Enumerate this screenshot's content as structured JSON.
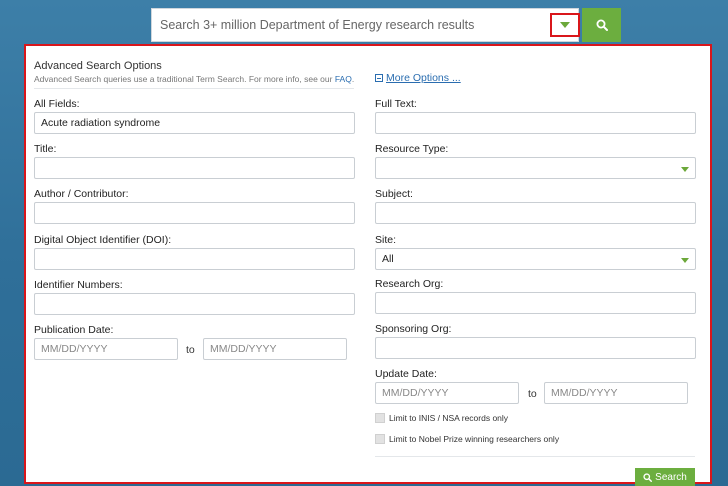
{
  "search": {
    "placeholder": "Search 3+ million Department of Energy research results"
  },
  "panel": {
    "title": "Advanced Search Options",
    "subtitle_prefix": "Advanced Search queries use a traditional Term Search. For more info, see our ",
    "faq_link": "FAQ",
    "subtitle_suffix": ".",
    "more_options": "More Options ..."
  },
  "left_fields": {
    "all_fields": {
      "label": "All Fields:",
      "value": "Acute radiation syndrome"
    },
    "title": {
      "label": "Title:"
    },
    "author": {
      "label": "Author / Contributor:"
    },
    "doi": {
      "label": "Digital Object Identifier (DOI):"
    },
    "identifier": {
      "label": "Identifier Numbers:"
    },
    "pub_date": {
      "label": "Publication Date:",
      "from_placeholder": "MM/DD/YYYY",
      "to_label": "to",
      "to_placeholder": "MM/DD/YYYY"
    }
  },
  "right_fields": {
    "full_text": {
      "label": "Full Text:"
    },
    "resource_type": {
      "label": "Resource Type:",
      "value": ""
    },
    "subject": {
      "label": "Subject:"
    },
    "site": {
      "label": "Site:",
      "value": "All"
    },
    "research_org": {
      "label": "Research Org:"
    },
    "sponsoring_org": {
      "label": "Sponsoring Org:"
    },
    "update_date": {
      "label": "Update Date:",
      "from_placeholder": "MM/DD/YYYY",
      "to_label": "to",
      "to_placeholder": "MM/DD/YYYY"
    },
    "limit_inis": "Limit to INIS / NSA records only",
    "limit_nobel": "Limit to Nobel Prize winning researchers only"
  },
  "buttons": {
    "search": "Search"
  },
  "colors": {
    "accent_green": "#6cae3f",
    "highlight_red": "#d9161b",
    "link_blue": "#2a6db0"
  }
}
